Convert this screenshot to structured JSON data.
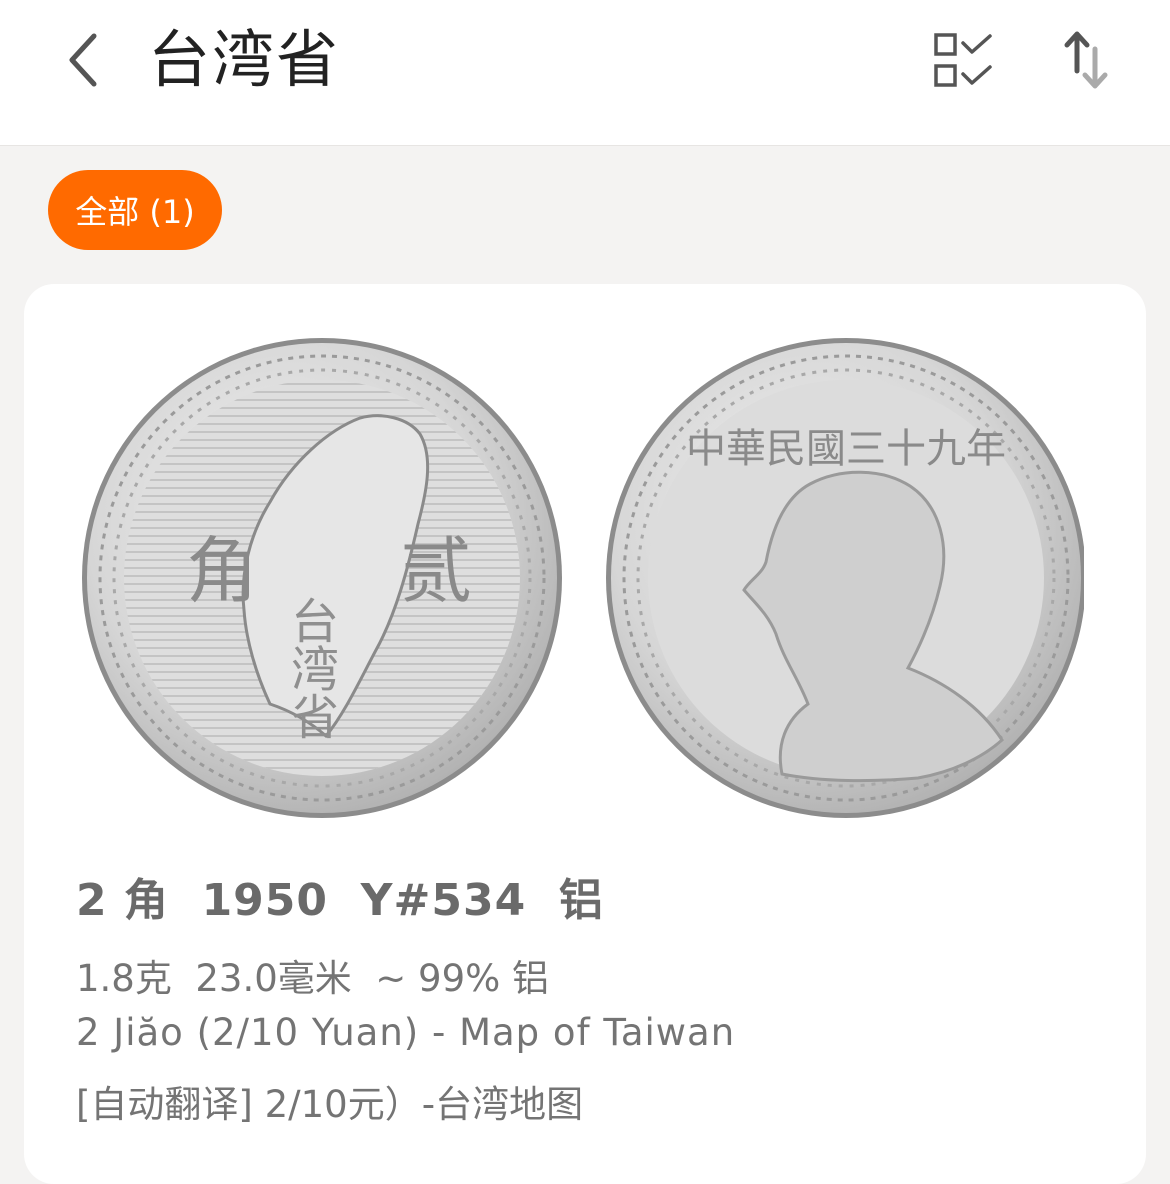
{
  "header": {
    "title": "台湾省",
    "back_icon": "chevron-left-icon",
    "select_icon": "checklist-icon",
    "sort_icon": "sort-arrows-icon"
  },
  "filters": [
    {
      "label": "全部 (1)",
      "active": true
    }
  ],
  "colors": {
    "accent": "#ff6a00",
    "background": "#f4f3f2",
    "card": "#ffffff"
  },
  "coin": {
    "title": "2 角  1950  Y#534  铝",
    "specs": "1.8克  23.0毫米  ~ 99% 铝",
    "name_en": "2 Jiăo (2/10 Yuan) - Map of Taiwan",
    "name_translated": "[自动翻译] 2/10元）-台湾地图",
    "obverse_chars": {
      "left": "角",
      "right": "贰",
      "map_text": "台湾省"
    },
    "reverse_legend": "中華民國三十九年"
  }
}
